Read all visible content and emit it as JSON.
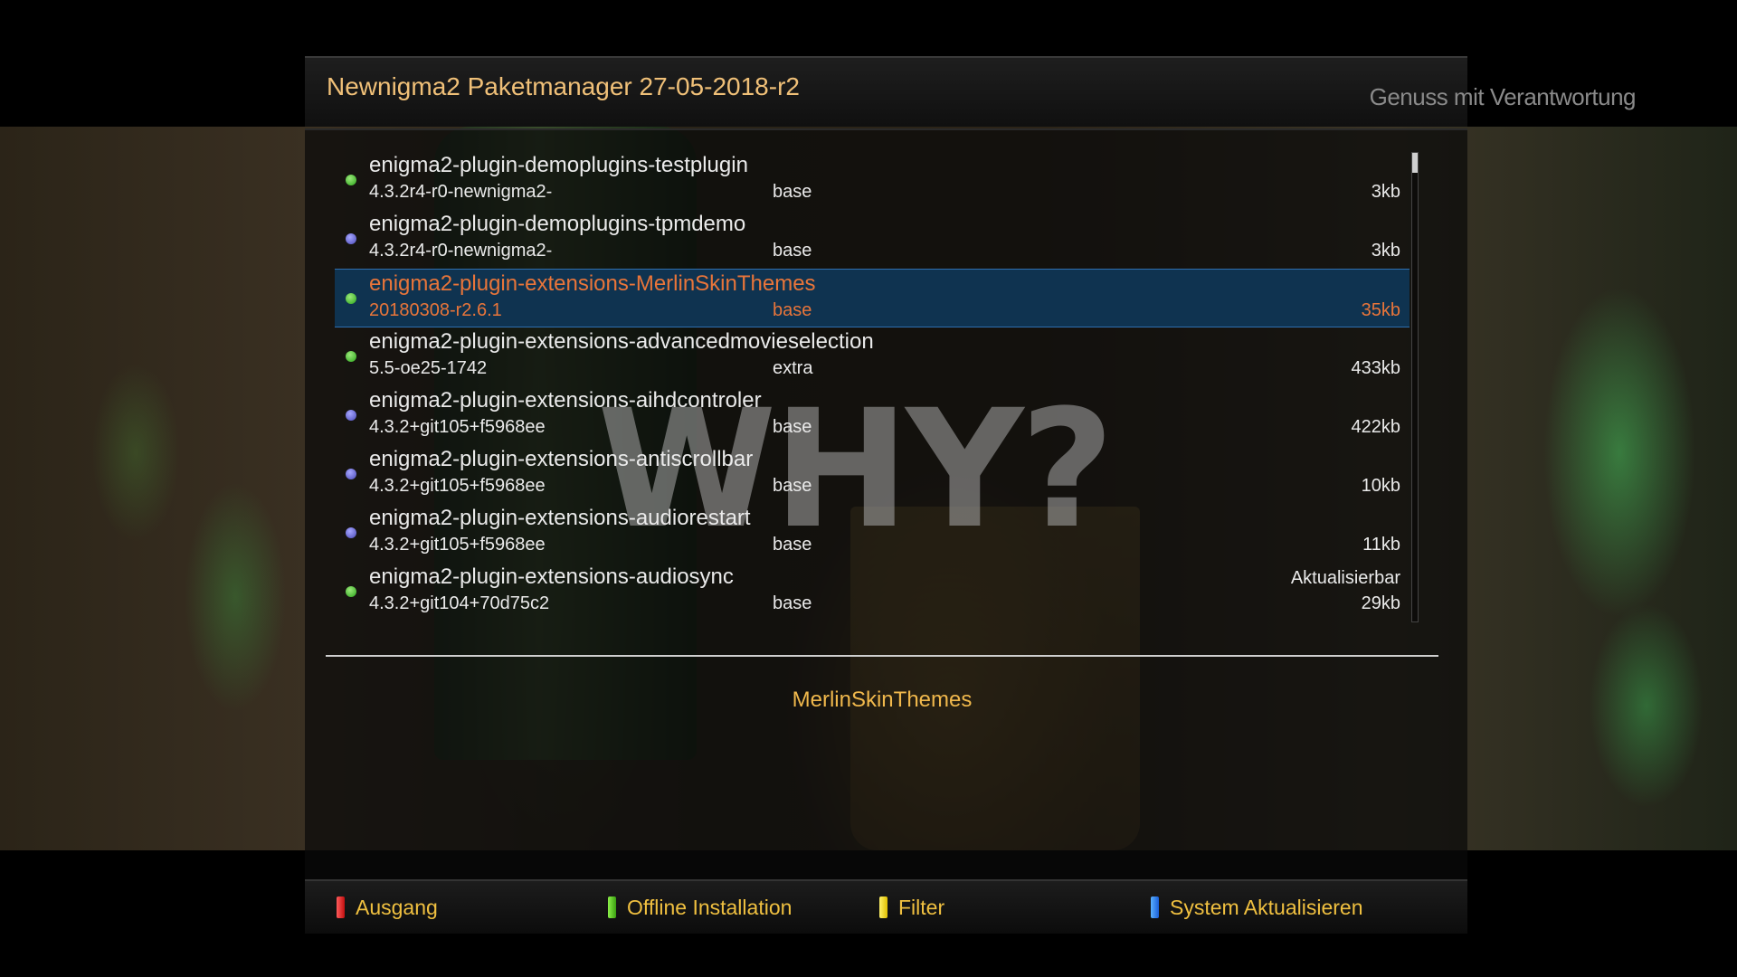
{
  "window": {
    "title": "Newnigma2 Paketmanager 27-05-2018-r2",
    "slogan": "Genuss mit Verantwortung"
  },
  "background": {
    "overlay_text": "WHY?"
  },
  "packages": [
    {
      "name": "enigma2-plugin-demoplugins-testplugin",
      "version": "4.3.2r4-r0-newnigma2-",
      "section": "base",
      "size": "3kb",
      "status": "",
      "dot": "green",
      "selected": false
    },
    {
      "name": "enigma2-plugin-demoplugins-tpmdemo",
      "version": "4.3.2r4-r0-newnigma2-",
      "section": "base",
      "size": "3kb",
      "status": "",
      "dot": "blue",
      "selected": false
    },
    {
      "name": "enigma2-plugin-extensions-MerlinSkinThemes",
      "version": "20180308-r2.6.1",
      "section": "base",
      "size": "35kb",
      "status": "",
      "dot": "green",
      "selected": true
    },
    {
      "name": "enigma2-plugin-extensions-advancedmovieselection",
      "version": "5.5-oe25-1742",
      "section": "extra",
      "size": "433kb",
      "status": "",
      "dot": "green",
      "selected": false
    },
    {
      "name": "enigma2-plugin-extensions-aihdcontroler",
      "version": "4.3.2+git105+f5968ee",
      "section": "base",
      "size": "422kb",
      "status": "",
      "dot": "blue",
      "selected": false
    },
    {
      "name": "enigma2-plugin-extensions-antiscrollbar",
      "version": "4.3.2+git105+f5968ee",
      "section": "base",
      "size": "10kb",
      "status": "",
      "dot": "blue",
      "selected": false
    },
    {
      "name": "enigma2-plugin-extensions-audiorestart",
      "version": "4.3.2+git105+f5968ee",
      "section": "base",
      "size": "11kb",
      "status": "",
      "dot": "blue",
      "selected": false
    },
    {
      "name": "enigma2-plugin-extensions-audiosync",
      "version": "4.3.2+git104+70d75c2",
      "section": "base",
      "size": "29kb",
      "status": "Aktualisierbar",
      "dot": "green",
      "selected": false
    }
  ],
  "description": "MerlinSkinThemes",
  "footer": {
    "red": {
      "label": "Ausgang",
      "color": "#e02020"
    },
    "green": {
      "label": "Offline Installation",
      "color": "#5ad020"
    },
    "yellow": {
      "label": "Filter",
      "color": "#f0e020"
    },
    "blue": {
      "label": "System Aktualisieren",
      "color": "#2a7fff"
    }
  },
  "colors": {
    "title": "#f0c078",
    "selected_text": "#e8753a",
    "selected_bg": "#0f3350",
    "description": "#f0b84c",
    "footer_label": "#f0c040"
  }
}
